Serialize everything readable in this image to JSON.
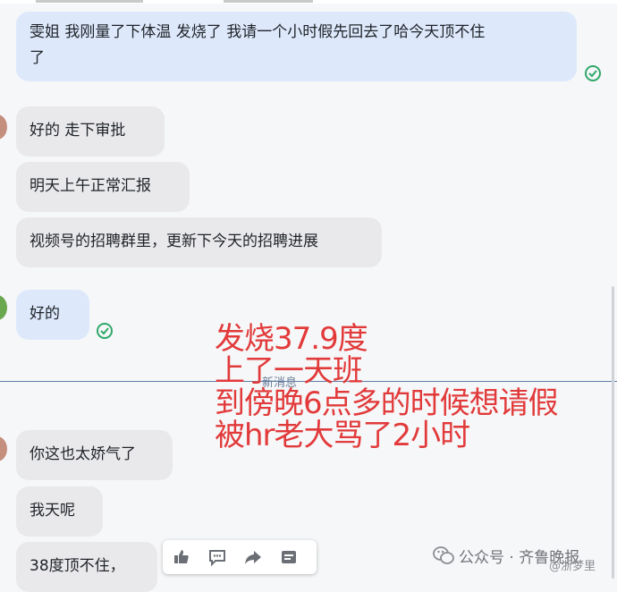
{
  "messages": [
    {
      "direction": "outgoing",
      "lines": [
        "雯姐 我刚量了下体温 发烧了 我请一个小时假先回去了哈今天顶不住",
        "了"
      ],
      "status": "read-check-icon"
    },
    {
      "direction": "incoming",
      "text": "好的  走下审批"
    },
    {
      "direction": "incoming",
      "text": "明天上午正常汇报"
    },
    {
      "direction": "incoming",
      "text": "视频号的招聘群里，更新下今天的招聘进展"
    },
    {
      "direction": "outgoing",
      "text": "好的",
      "status": "read-check-icon"
    },
    {
      "direction": "incoming",
      "text": "你这也太娇气了"
    },
    {
      "direction": "incoming",
      "text": "我天呢"
    },
    {
      "direction": "incoming",
      "text": "38度顶不住，"
    }
  ],
  "divider": {
    "label": "新消息"
  },
  "overlay": {
    "color": "#e23a3a",
    "lines": [
      "发烧37.9度",
      "上了一天班",
      "到傍晚6点多的时候想请假",
      "被hr老大骂了2小时"
    ]
  },
  "action_bar": {
    "icons": [
      "thumbs-up-icon",
      "comment-icon",
      "forward-icon",
      "more-icon"
    ]
  },
  "watermark": {
    "text": "公众号 · 齐鲁晚报",
    "secondary": "@浙梦里"
  },
  "colors": {
    "outgoing_bubble": "#dde9fb",
    "incoming_bubble": "#e9e9eb",
    "check": "#2fa86a",
    "divider": "#5d7ea8"
  }
}
